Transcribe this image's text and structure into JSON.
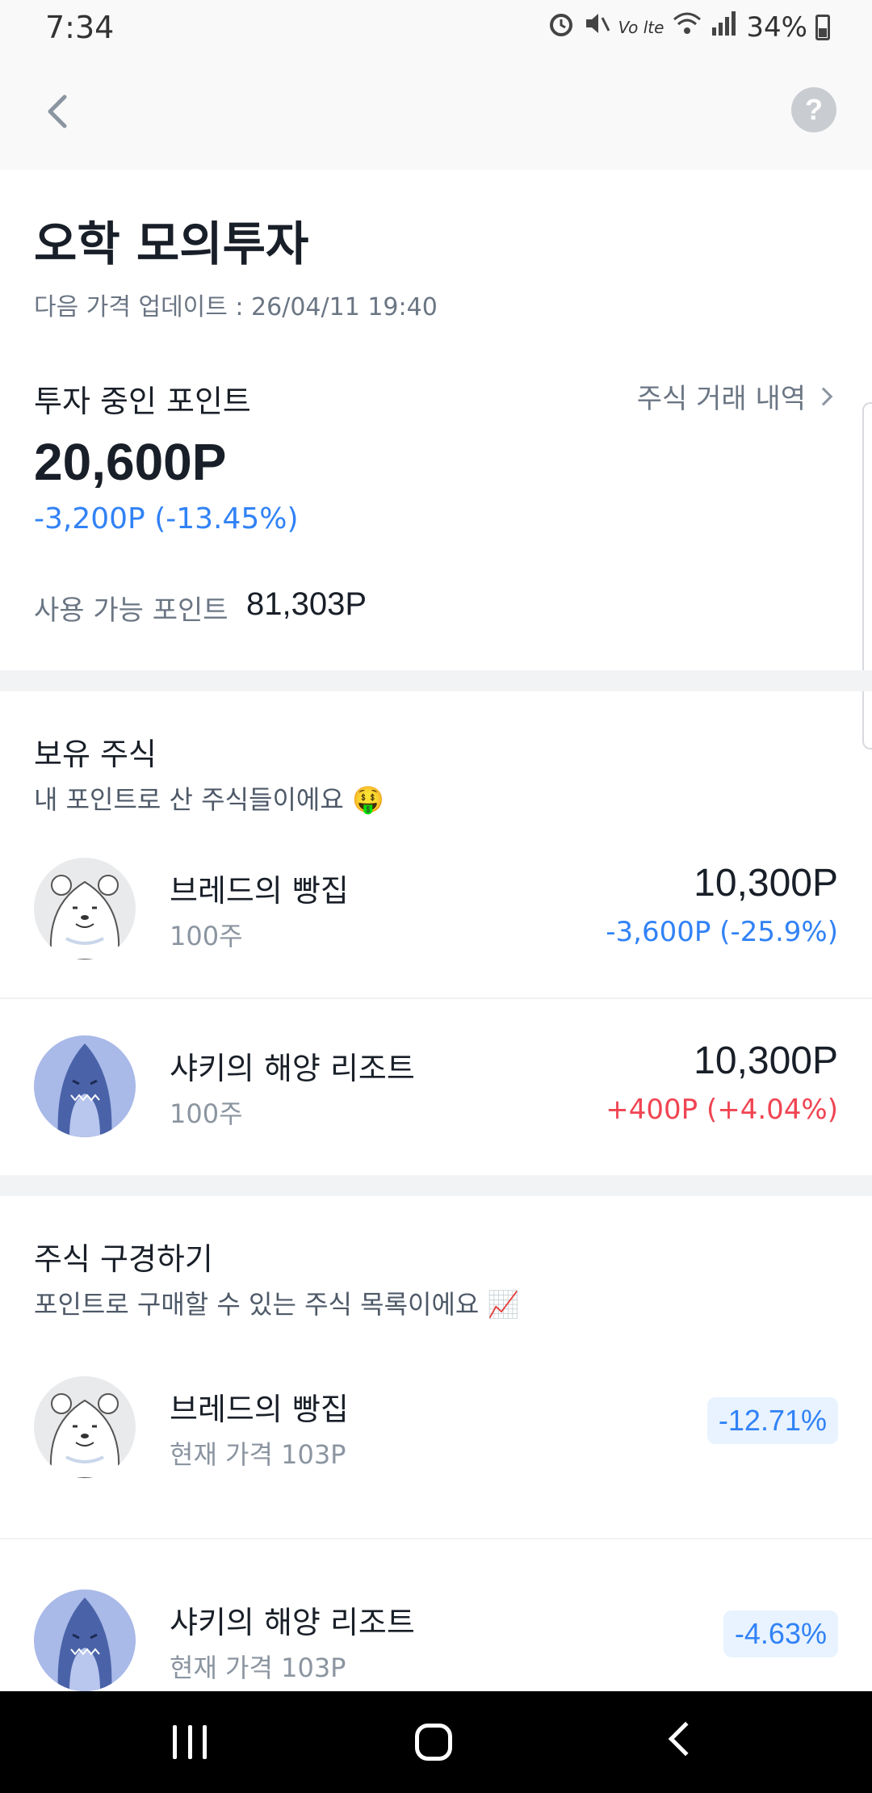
{
  "status_bar": {
    "time": "7:34",
    "network_label": "Vo lte",
    "battery": "34%",
    "icons": [
      "alarm-icon",
      "mute-icon",
      "volte-icon",
      "wifi-icon",
      "signal-icon",
      "battery-icon"
    ]
  },
  "app_bar": {
    "back_icon": "chevron-left-icon",
    "help_label": "?"
  },
  "header": {
    "title": "오학 모의투자",
    "update_text": "다음 가격 업데이트 : 26/04/11 19:40"
  },
  "points": {
    "label": "투자 중인 포인트",
    "history_link": "주식 거래 내역",
    "value": "20,600P",
    "change": "-3,200P (-13.45%)",
    "available_label": "사용 가능 포인트",
    "available_value": "81,303P"
  },
  "holdings": {
    "title": "보유 주식",
    "subtitle": "내 포인트로 산 주식들이에요 🤑",
    "items": [
      {
        "name": "브레드의 빵집",
        "shares": "100주",
        "value": "10,300P",
        "change": "-3,600P (-25.9%)",
        "direction": "down",
        "avatar": "bear"
      },
      {
        "name": "샤키의 해양 리조트",
        "shares": "100주",
        "value": "10,300P",
        "change": "+400P (+4.04%)",
        "direction": "up",
        "avatar": "shark"
      }
    ]
  },
  "browse": {
    "title": "주식 구경하기",
    "subtitle": "포인트로 구매할 수 있는 주식 목록이에요 📈",
    "items": [
      {
        "name": "브레드의 빵집",
        "price": "현재 가격 103P",
        "pct": "-12.71%",
        "avatar": "bear"
      },
      {
        "name": "샤키의 해양 리조트",
        "price": "현재 가격 103P",
        "pct": "-4.63%",
        "avatar": "shark"
      }
    ]
  },
  "colors": {
    "down": "#3182f6",
    "up": "#f04452",
    "badge_bg": "#e8f3ff",
    "shark_bg": "#a9b9e8",
    "bear_bg": "#e9eaec"
  }
}
